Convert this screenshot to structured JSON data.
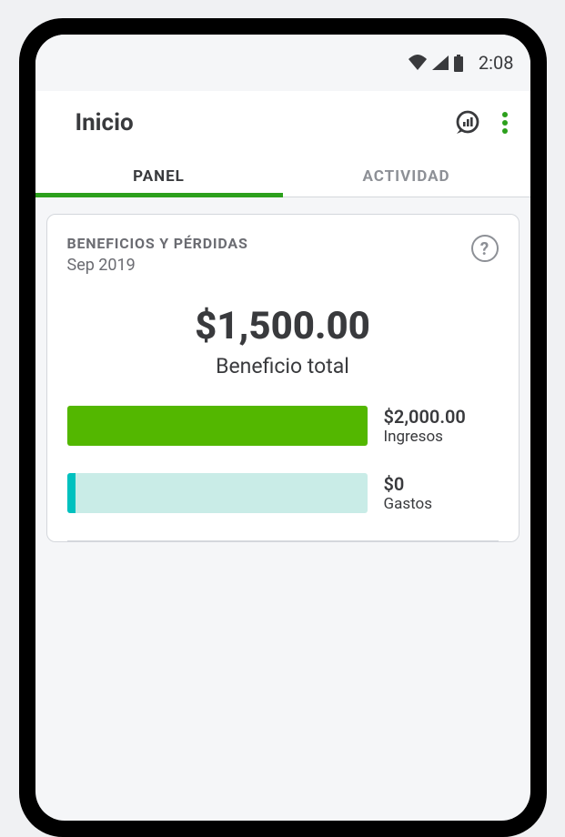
{
  "status": {
    "time": "2:08"
  },
  "header": {
    "title": "Inicio"
  },
  "tabs": [
    {
      "label": "PANEL",
      "active": true
    },
    {
      "label": "ACTIVIDAD",
      "active": false
    }
  ],
  "card": {
    "title": "BENEFICIOS Y PÉRDIDAS",
    "period": "Sep 2019",
    "total_amount": "$1,500.00",
    "total_label": "Beneficio total",
    "rows": [
      {
        "amount": "$2,000.00",
        "category": "Ingresos",
        "fill_pct": 100,
        "color": "#53b700"
      },
      {
        "amount": "$0",
        "category": "Gastos",
        "fill_pct": 0,
        "color": "#00c1bf"
      }
    ]
  }
}
